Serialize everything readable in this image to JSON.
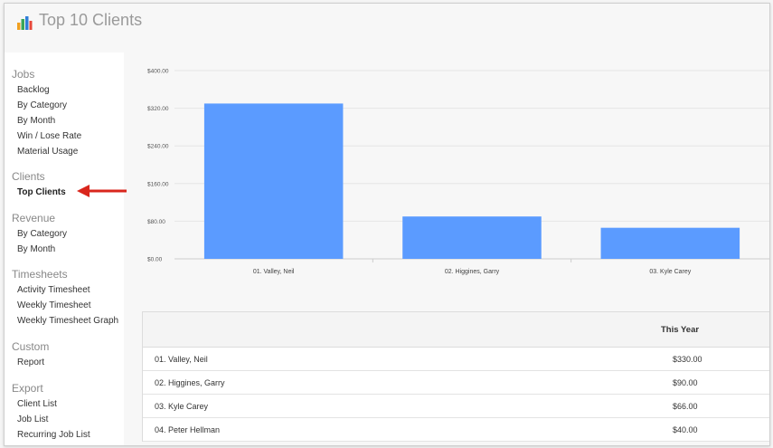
{
  "header": {
    "title": "Top 10 Clients"
  },
  "sidebar": {
    "sections": [
      {
        "label": "Jobs",
        "items": [
          "Backlog",
          "By Category",
          "By Month",
          "Win / Lose Rate",
          "Material Usage"
        ]
      },
      {
        "label": "Clients",
        "items": [
          "Top Clients"
        ]
      },
      {
        "label": "Revenue",
        "items": [
          "By Category",
          "By Month"
        ]
      },
      {
        "label": "Timesheets",
        "items": [
          "Activity Timesheet",
          "Weekly Timesheet",
          "Weekly Timesheet Graph"
        ]
      },
      {
        "label": "Custom",
        "items": [
          "Report"
        ]
      },
      {
        "label": "Export",
        "items": [
          "Client List",
          "Job List",
          "Recurring Job List"
        ]
      }
    ],
    "active_item": "Top Clients"
  },
  "chart_data": {
    "type": "bar",
    "categories": [
      "01. Valley, Neil",
      "02. Higgines, Garry",
      "03. Kyle Carey"
    ],
    "values": [
      330,
      90,
      66
    ],
    "yticks": [
      "$0.00",
      "$80.00",
      "$160.00",
      "$240.00",
      "$320.00",
      "$400.00"
    ],
    "ylim": [
      0,
      400
    ],
    "bar_color": "#5b9bff"
  },
  "table": {
    "header": "This Year",
    "rows": [
      {
        "client": "01. Valley, Neil",
        "value": "$330.00"
      },
      {
        "client": "02. Higgines, Garry",
        "value": "$90.00"
      },
      {
        "client": "03. Kyle Carey",
        "value": "$66.00"
      },
      {
        "client": "04. Peter Hellman",
        "value": "$40.00"
      }
    ]
  },
  "colors": {
    "accent": "#5b9bff",
    "arrow": "#d9261c"
  }
}
